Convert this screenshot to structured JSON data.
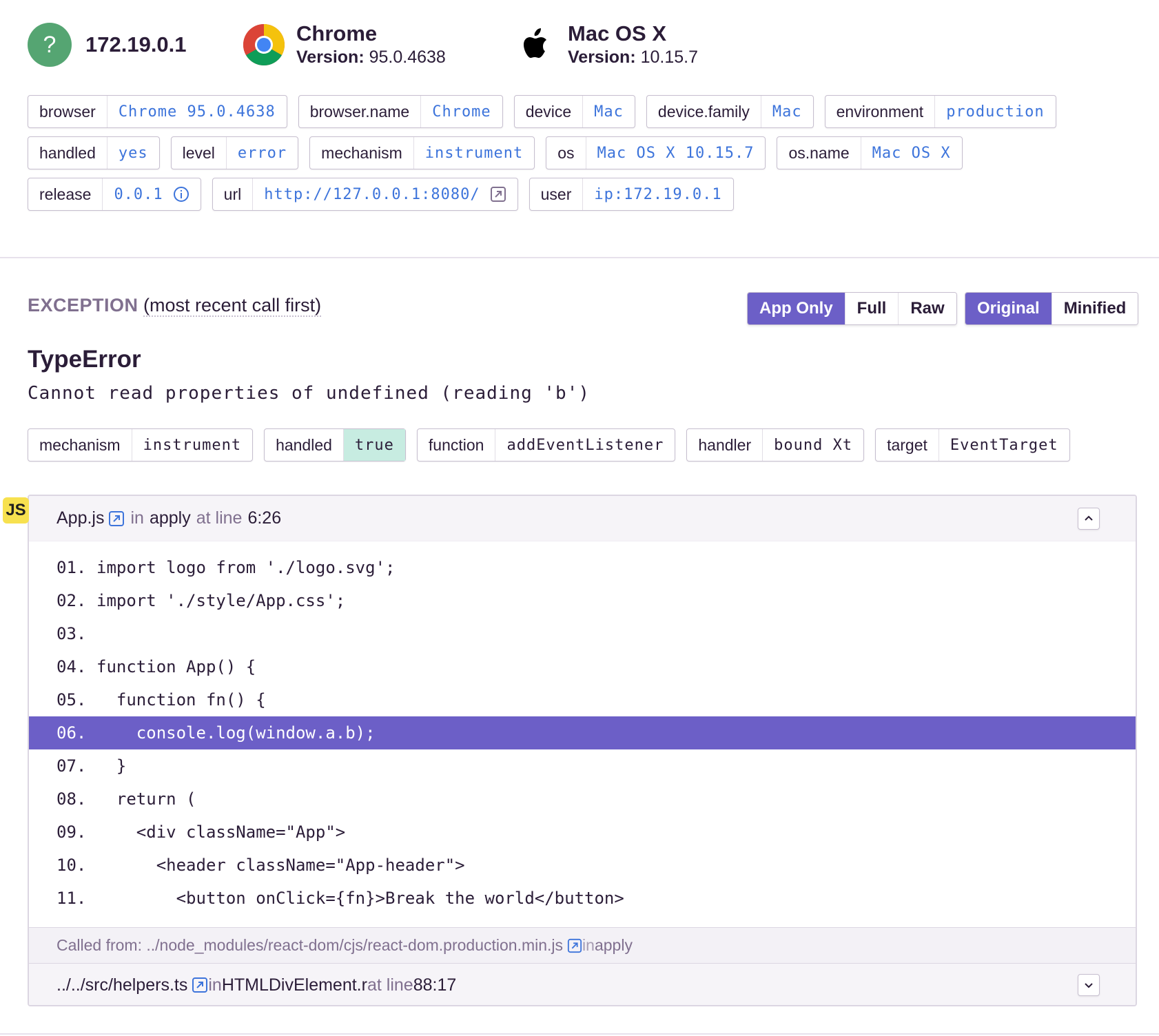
{
  "context": {
    "user": {
      "icon": "question-mark-avatar-icon",
      "ip": "172.19.0.1"
    },
    "browser": {
      "icon": "chrome-logo-icon",
      "name": "Chrome",
      "version_label": "Version:",
      "version": "95.0.4638"
    },
    "os": {
      "icon": "apple-logo-icon",
      "name": "Mac OS X",
      "version_label": "Version:",
      "version": "10.15.7"
    }
  },
  "tags": {
    "row1": [
      {
        "key": "browser",
        "value": "Chrome 95.0.4638"
      },
      {
        "key": "browser.name",
        "value": "Chrome"
      },
      {
        "key": "device",
        "value": "Mac"
      },
      {
        "key": "device.family",
        "value": "Mac"
      },
      {
        "key": "environment",
        "value": "production"
      }
    ],
    "row2": [
      {
        "key": "handled",
        "value": "yes"
      },
      {
        "key": "level",
        "value": "error"
      },
      {
        "key": "mechanism",
        "value": "instrument"
      },
      {
        "key": "os",
        "value": "Mac OS X 10.15.7"
      },
      {
        "key": "os.name",
        "value": "Mac OS X"
      }
    ],
    "row3": [
      {
        "key": "release",
        "value": "0.0.1"
      },
      {
        "key": "url",
        "value": "http://127.0.0.1:8080/"
      },
      {
        "key": "user",
        "value": "ip:172.19.0.1"
      }
    ]
  },
  "exception": {
    "title": "EXCEPTION",
    "subtitle": "(most recent call first)",
    "view_options": [
      "App Only",
      "Full",
      "Raw"
    ],
    "view_selected": "App Only",
    "source_options": [
      "Original",
      "Minified"
    ],
    "source_selected": "Original",
    "type": "TypeError",
    "message": "Cannot read properties of undefined (reading 'b')",
    "mechanism_tags": [
      {
        "key": "mechanism",
        "value": "instrument"
      },
      {
        "key": "handled",
        "value": "true"
      },
      {
        "key": "function",
        "value": "addEventListener"
      },
      {
        "key": "handler",
        "value": "bound Xt"
      },
      {
        "key": "target",
        "value": "EventTarget"
      }
    ]
  },
  "frame": {
    "platform_badge": "JS",
    "file": "App.js",
    "in_label": "in",
    "function": "apply",
    "at_line_label": "at line",
    "line": "6:26",
    "code": [
      {
        "num": "01.",
        "text": "import logo from './logo.svg';"
      },
      {
        "num": "02.",
        "text": "import './style/App.css';"
      },
      {
        "num": "03.",
        "text": ""
      },
      {
        "num": "04.",
        "text": "function App() {"
      },
      {
        "num": "05.",
        "text": "  function fn() {"
      },
      {
        "num": "06.",
        "text": "    console.log(window.a.b);"
      },
      {
        "num": "07.",
        "text": "  }"
      },
      {
        "num": "08.",
        "text": "  return ("
      },
      {
        "num": "09.",
        "text": "    <div className=\"App\">"
      },
      {
        "num": "10.",
        "text": "      <header className=\"App-header\">"
      },
      {
        "num": "11.",
        "text": "        <button onClick={fn}>Break the world</button>"
      }
    ],
    "active_line": "06.",
    "called_from_label": "Called from:",
    "called_from_file": "../node_modules/react-dom/cjs/react-dom.production.min.js",
    "called_from_in": "in",
    "called_from_function": "apply"
  },
  "next_frame": {
    "file": "../../src/helpers.ts",
    "in_label": "in",
    "function": "HTMLDivElement.r",
    "at_line_label": "at line",
    "line": "88:17"
  },
  "colors": {
    "accent": "#6c5fc7",
    "link": "#3d74db",
    "avatar": "#55a572",
    "handled_true": "#c7ece1",
    "js_badge": "#f7e14f"
  }
}
